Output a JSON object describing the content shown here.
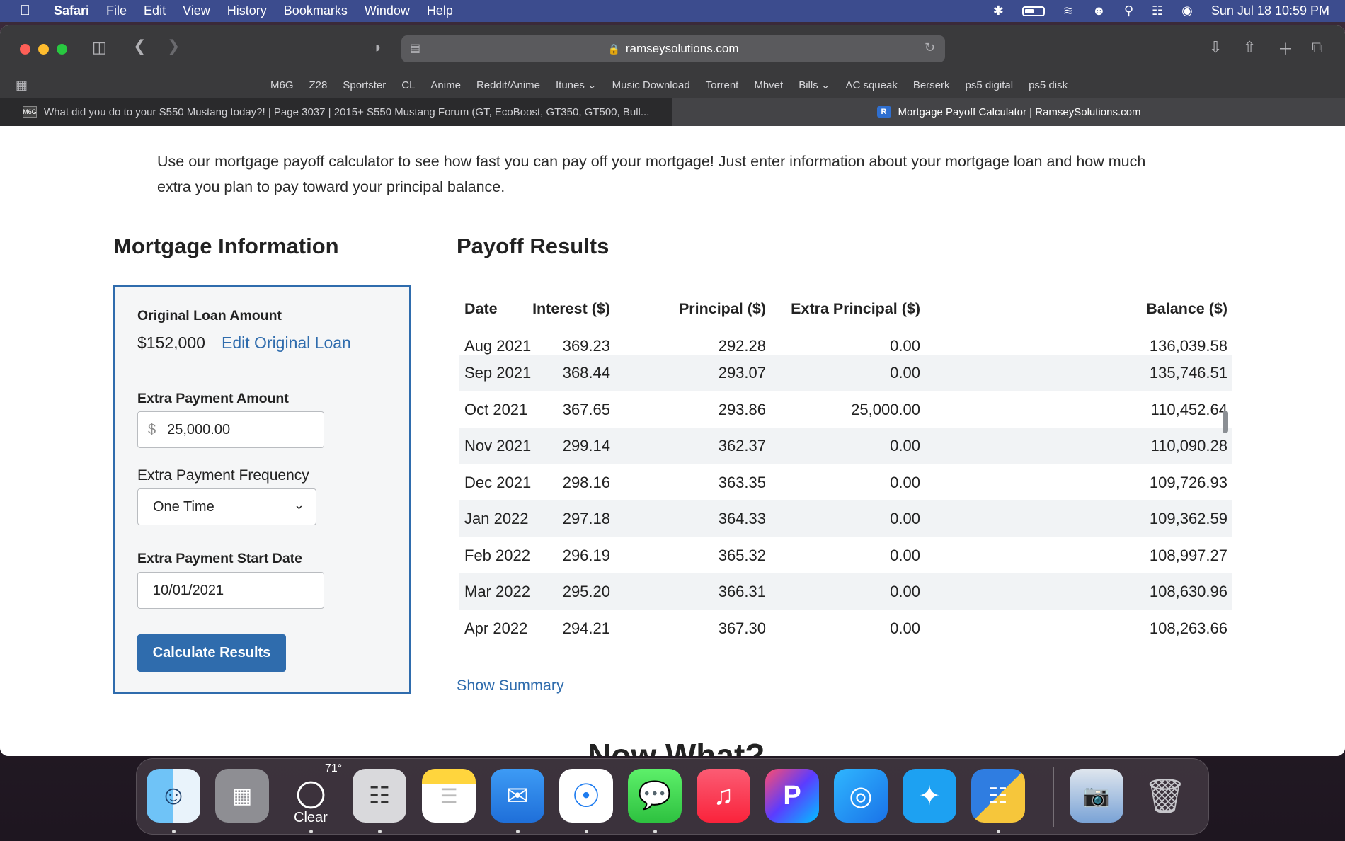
{
  "menubar": {
    "app": "Safari",
    "items": [
      "File",
      "Edit",
      "View",
      "History",
      "Bookmarks",
      "Window",
      "Help"
    ],
    "clock": "Sun Jul 18  10:59 PM"
  },
  "browser": {
    "url": "ramseysolutions.com",
    "bookmarks": [
      "M6G",
      "Z28",
      "Sportster",
      "CL",
      "Anime",
      "Reddit/Anime",
      "Itunes ⌄",
      "Music Download",
      "Torrent",
      "Mhvet",
      "Bills ⌄",
      "AC squeak",
      "Berserk",
      "ps5 digital",
      "ps5 disk"
    ],
    "tabs": [
      {
        "title": "What did you do to your S550 Mustang today?! | Page 3037 | 2015+ S550 Mustang Forum (GT, EcoBoost, GT350, GT500, Bull...",
        "favicon": "M6G",
        "active": false
      },
      {
        "title": "Mortgage Payoff Calculator | RamseySolutions.com",
        "favicon": "R",
        "active": true
      }
    ]
  },
  "page": {
    "intro": "Use our mortgage payoff calculator to see how fast you can pay off your mortgage! Just enter information about your mortgage loan and how much extra you plan to pay toward your principal balance.",
    "mortgage_heading": "Mortgage Information",
    "payoff_heading": "Payoff Results",
    "form": {
      "original_loan_label": "Original Loan Amount",
      "original_loan_value": "$152,000",
      "edit_link": "Edit Original Loan",
      "extra_amount_label": "Extra Payment Amount",
      "currency_symbol": "$",
      "extra_amount_value": "25,000.00",
      "frequency_label": "Extra Payment Frequency",
      "frequency_value": "One Time",
      "start_date_label": "Extra Payment Start Date",
      "start_date_value": "10/01/2021",
      "calculate_button": "Calculate Results"
    },
    "table": {
      "headers": [
        "Date",
        "Interest ($)",
        "Principal ($)",
        "Extra Principal ($)",
        "Balance ($)"
      ],
      "rows": [
        [
          "Aug 2021",
          "369.23",
          "292.28",
          "0.00",
          "136,039.58"
        ],
        [
          "Sep 2021",
          "368.44",
          "293.07",
          "0.00",
          "135,746.51"
        ],
        [
          "Oct 2021",
          "367.65",
          "293.86",
          "25,000.00",
          "110,452.64"
        ],
        [
          "Nov 2021",
          "299.14",
          "362.37",
          "0.00",
          "110,090.28"
        ],
        [
          "Dec 2021",
          "298.16",
          "363.35",
          "0.00",
          "109,726.93"
        ],
        [
          "Jan 2022",
          "297.18",
          "364.33",
          "0.00",
          "109,362.59"
        ],
        [
          "Feb 2022",
          "296.19",
          "365.32",
          "0.00",
          "108,997.27"
        ],
        [
          "Mar 2022",
          "295.20",
          "366.31",
          "0.00",
          "108,630.96"
        ],
        [
          "Apr 2022",
          "294.21",
          "367.30",
          "0.00",
          "108,263.66"
        ]
      ]
    },
    "show_summary": "Show Summary",
    "next_heading": "Now What?"
  },
  "dock": {
    "weather_temp": "71°",
    "weather_condition": "Clear",
    "apps": [
      "finder",
      "launchpad",
      "weather",
      "calculator",
      "notes",
      "mail",
      "safari",
      "messages",
      "music",
      "pandora",
      "podcast-app",
      "twitter",
      "numbers-app",
      "photos-folder",
      "trash"
    ]
  }
}
